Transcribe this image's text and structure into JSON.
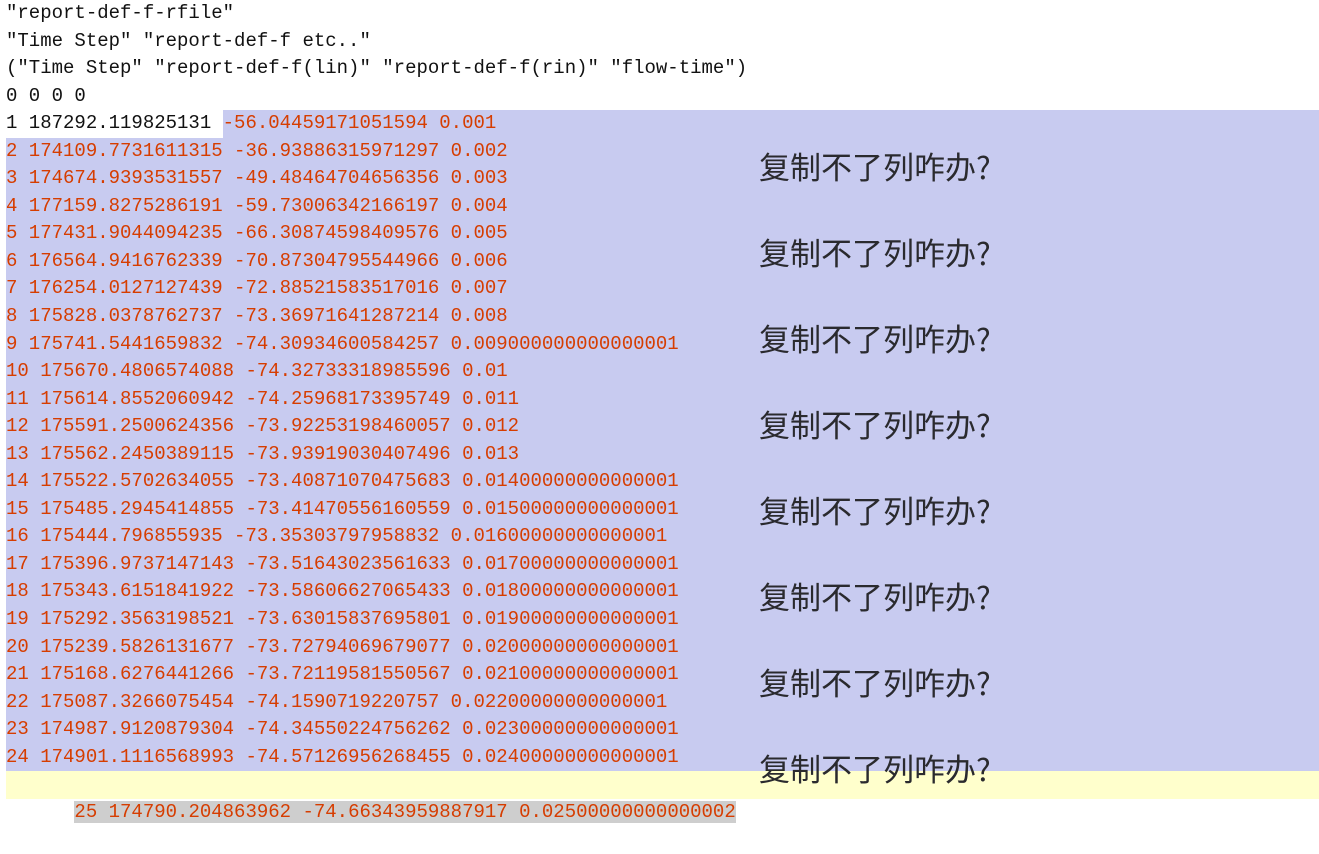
{
  "header": {
    "line1": "\"report-def-f-rfile\"",
    "line2": "\"Time Step\" \"report-def-f etc..\"",
    "line3": "(\"Time Step\" \"report-def-f(lin)\" \"report-def-f(rin)\" \"flow-time\")",
    "zeros": "0 0 0 0"
  },
  "row1": {
    "prefix": "1 187292.119825131 ",
    "suffix": "-56.04459171051594 0.001"
  },
  "rows": [
    "2 174109.7731611315 -36.93886315971297 0.002",
    "3 174674.9393531557 -49.48464704656356 0.003",
    "4 177159.8275286191 -59.73006342166197 0.004",
    "5 177431.9044094235 -66.30874598409576 0.005",
    "6 176564.9416762339 -70.87304795544966 0.006",
    "7 176254.0127127439 -72.88521583517016 0.007",
    "8 175828.0378762737 -73.36971641287214 0.008",
    "9 175741.5441659832 -74.30934600584257 0.009000000000000001",
    "10 175670.4806574088 -74.32733318985596 0.01",
    "11 175614.8552060942 -74.25968173395749 0.011",
    "12 175591.2500624356 -73.92253198460057 0.012",
    "13 175562.2450389115 -73.93919030407496 0.013",
    "14 175522.5702634055 -73.40871070475683 0.01400000000000001",
    "15 175485.2945414855 -73.41470556160559 0.01500000000000001",
    "16 175444.796855935 -73.35303797958832 0.01600000000000001",
    "17 175396.9737147143 -73.51643023561633 0.01700000000000001",
    "18 175343.6151841922 -73.58606627065433 0.01800000000000001",
    "19 175292.3563198521 -73.63015837695801 0.01900000000000001",
    "20 175239.5826131677 -73.72794069679077 0.02000000000000001",
    "21 175168.6276441266 -73.72119581550567 0.02100000000000001",
    "22 175087.3266075454 -74.1590719220757 0.02200000000000001",
    "23 174987.9120879304 -74.34550224756262 0.02300000000000001",
    "24 174901.1116568993 -74.57126956268455 0.02400000000000001"
  ],
  "lastRow": "25 174790.204863962 -74.66343959887917 0.02500000000000002",
  "overlay": {
    "question": "复制不了列咋办?",
    "repeat": 8
  }
}
